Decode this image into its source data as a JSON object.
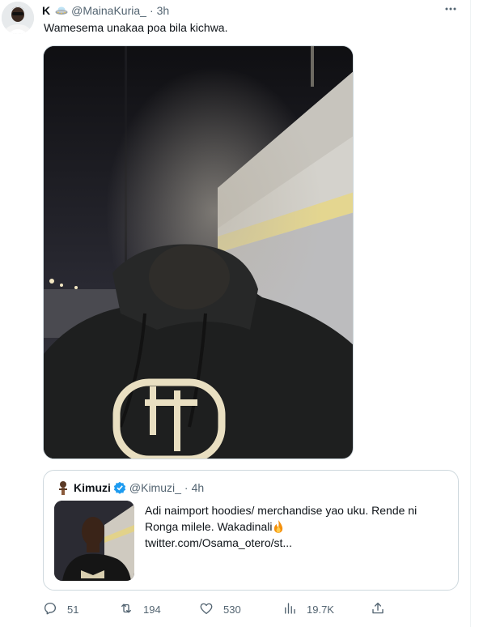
{
  "tweet": {
    "author_name": "K",
    "handle": "@MainaKuria_",
    "separator": "·",
    "time": "3h",
    "text": "Wamesema unakaa poa bila kichwa."
  },
  "quote": {
    "author_name": "Kimuzi",
    "handle": "@Kimuzi_",
    "separator": "·",
    "time": "4h",
    "line1": "Adi naimport hoodies/ merchandise yao uku. Rende ni",
    "line2": "Ronga milele. Wakadinali",
    "link": "twitter.com/Osama_otero/st..."
  },
  "actions": {
    "reply_count": "51",
    "retweet_count": "194",
    "like_count": "530",
    "views_count": "19.7K"
  },
  "icons": {
    "more": "more-icon",
    "reply": "reply-icon",
    "retweet": "retweet-icon",
    "like": "heart-icon",
    "views": "views-icon",
    "share": "share-icon",
    "verified": "verified-badge-icon",
    "fire": "fire-emoji-icon"
  },
  "colors": {
    "verified_blue": "#1d9bf0",
    "secondary_text": "#536471",
    "border": "#cfd9de"
  }
}
